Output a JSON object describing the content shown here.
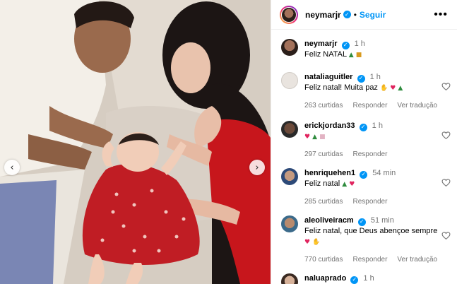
{
  "post": {
    "author": "neymarjr",
    "follow_label": "Seguir",
    "separator": "•",
    "more_label": "•••",
    "prev_label": "‹",
    "next_label": "›"
  },
  "caption": {
    "username": "neymarjr",
    "time": "1 h",
    "text": "Feliz NATAL",
    "emojis": [
      "tree",
      "gift"
    ]
  },
  "comments": [
    {
      "username": "nataliaguitler",
      "verified": true,
      "time": "1 h",
      "text": "Feliz natal! Muita paz",
      "emojis": [
        "raised-hands",
        "heart",
        "tree"
      ],
      "likes": "263 curtidas",
      "reply": "Responder",
      "translate": "Ver tradução"
    },
    {
      "username": "erickjordan33",
      "verified": true,
      "time": "1 h",
      "text": "",
      "emojis": [
        "heart",
        "tree",
        "gift"
      ],
      "likes": "297 curtidas",
      "reply": "Responder",
      "translate": ""
    },
    {
      "username": "henriquehen1",
      "verified": true,
      "time": "54 min",
      "text": "Feliz natal",
      "emojis": [
        "tree",
        "heart"
      ],
      "likes": "285 curtidas",
      "reply": "Responder",
      "translate": ""
    },
    {
      "username": "aleoliveiracm",
      "verified": true,
      "time": "51 min",
      "text": "Feliz natal, que Deus abençoe sempre",
      "emojis": [
        "heart",
        "praying-hands"
      ],
      "likes": "770 curtidas",
      "reply": "Responder",
      "translate": "Ver tradução"
    },
    {
      "username": "naluaprado",
      "verified": true,
      "time": "1 h",
      "text": "",
      "emojis": [],
      "likes": "",
      "reply": "",
      "translate": ""
    }
  ],
  "icons": {
    "heart": "heart-outline-icon",
    "verified": "verified-badge-icon",
    "glyphs": {
      "tree": "▲",
      "gift": "■",
      "heart": "♥",
      "raised-hands": "✋",
      "praying-hands": "✋"
    }
  },
  "colors": {
    "verified": "#0095f6",
    "follow": "#0095f6",
    "secondary_text": "#737373",
    "border": "#efefef"
  }
}
